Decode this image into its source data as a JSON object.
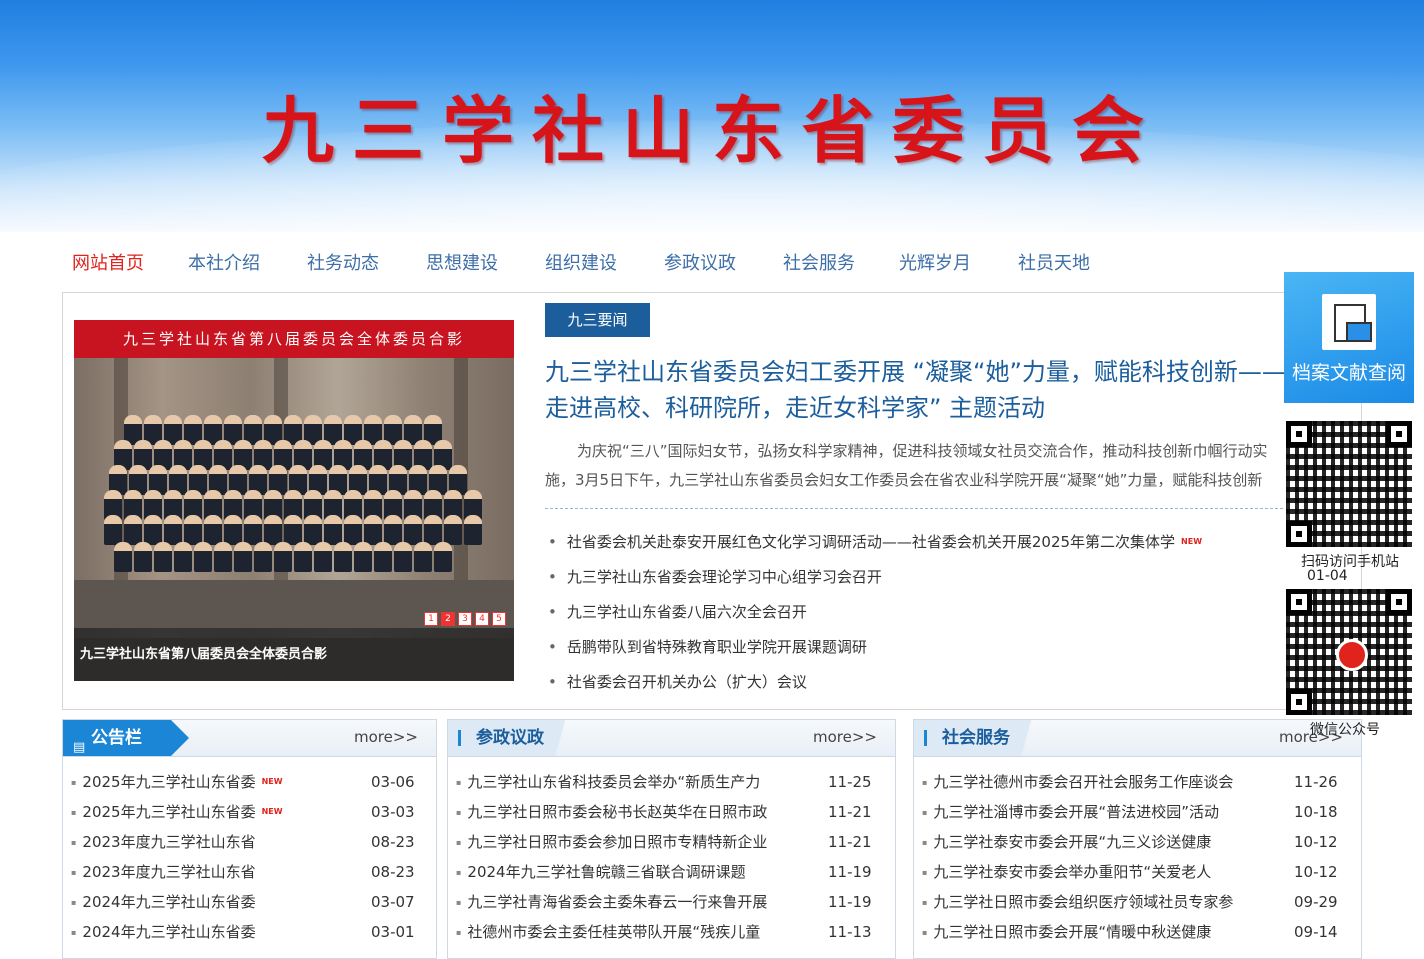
{
  "site": {
    "title": "九三学社山东省委员会"
  },
  "nav": {
    "items": [
      {
        "label": "网站首页",
        "active": true
      },
      {
        "label": "本社介绍"
      },
      {
        "label": "社务动态"
      },
      {
        "label": "思想建设"
      },
      {
        "label": "组织建设"
      },
      {
        "label": "参政议政"
      },
      {
        "label": "社会服务"
      },
      {
        "label": "光辉岁月"
      },
      {
        "label": "社员天地"
      }
    ]
  },
  "slideshow": {
    "banner": "九三学社山东省第八届委员会全体委员合影",
    "caption": "九三学社山东省第八届委员会全体委员合影",
    "pages": [
      "1",
      "2",
      "3",
      "4",
      "5"
    ],
    "current_page": 2
  },
  "news": {
    "tag": "九三要闻",
    "headline": "九三学社山东省委员会妇工委开展 “凝聚“她”力量，赋能科技创新——走进高校、科研院所，走近女科学家” 主题活动",
    "summary": "为庆祝“三八”国际妇女节，弘扬女科学家精神，促进科技领域女社员交流合作，推动科技创新巾帼行动实施，3月5日下午，九三学社山东省委员会妇女工作委员会在省农业科学院开展“凝聚“她”力量，赋能科技创新",
    "items": [
      {
        "text": "社省委会机关赴泰安开展红色文化学习调研活动——社省委会机关开展2025年第二次集体学",
        "new": "NEW"
      },
      {
        "text": "九三学社山东省委会理论学习中心组学习会召开"
      },
      {
        "text": "九三学社山东省委八届六次全会召开"
      },
      {
        "text": "岳鹏带队到省特殊教育职业学院开展课题调研"
      },
      {
        "text": "社省委会召开机关办公（扩大）会议"
      }
    ]
  },
  "panels": {
    "notice": {
      "title": "公告栏",
      "more": "more>>",
      "items": [
        {
          "text": "2025年九三学社山东省委",
          "new": "NEW",
          "date": "03-06"
        },
        {
          "text": "2025年九三学社山东省委",
          "new": "NEW",
          "date": "03-03"
        },
        {
          "text": "2023年度九三学社山东省",
          "date": "08-23"
        },
        {
          "text": "2023年度九三学社山东省",
          "date": "08-23"
        },
        {
          "text": "2024年九三学社山东省委",
          "date": "03-07"
        },
        {
          "text": "2024年九三学社山东省委",
          "date": "03-01"
        }
      ]
    },
    "politics": {
      "title": "参政议政",
      "more": "more>>",
      "items": [
        {
          "text": "九三学社山东省科技委员会举办“新质生产力",
          "date": "11-25"
        },
        {
          "text": "九三学社日照市委会秘书长赵英华在日照市政",
          "date": "11-21"
        },
        {
          "text": "九三学社日照市委会参加日照市专精特新企业",
          "date": "11-21"
        },
        {
          "text": "2024年九三学社鲁皖赣三省联合调研课题",
          "date": "11-19"
        },
        {
          "text": "九三学社青海省委会主委朱春云一行来鲁开展",
          "date": "11-19"
        },
        {
          "text": "社德州市委会主委任桂英带队开展“残疾儿童",
          "date": "11-13"
        }
      ]
    },
    "service": {
      "title": "社会服务",
      "more": "more>>",
      "items": [
        {
          "text": "九三学社德州市委会召开社会服务工作座谈会",
          "date": "11-26"
        },
        {
          "text": "九三学社淄博市委会开展“普法进校园”活动",
          "date": "10-18"
        },
        {
          "text": "九三学社泰安市委会开展“九三义诊送健康",
          "date": "10-12"
        },
        {
          "text": "九三学社泰安市委会举办重阳节“关爱老人",
          "date": "10-12"
        },
        {
          "text": "九三学社日照市委会组织医疗领域社员专家参",
          "date": "09-29"
        },
        {
          "text": "九三学社日照市委会开展“情暖中秋送健康",
          "date": "09-14"
        }
      ]
    }
  },
  "sidebar": {
    "archive_label": "档案文献查阅",
    "qr1_caption": "扫码访问手机站",
    "date_label": "01-04",
    "qr2_caption": "微信公众号"
  },
  "colors": {
    "brand_red": "#d8141b",
    "nav_blue": "#3e6fa8",
    "accent_blue": "#1c5e9c",
    "new_red": "#e0231c"
  },
  "icons": {
    "notice": "notice-doc-icon",
    "archive": "document-folder-icon",
    "qr": "qr-code-icon"
  }
}
